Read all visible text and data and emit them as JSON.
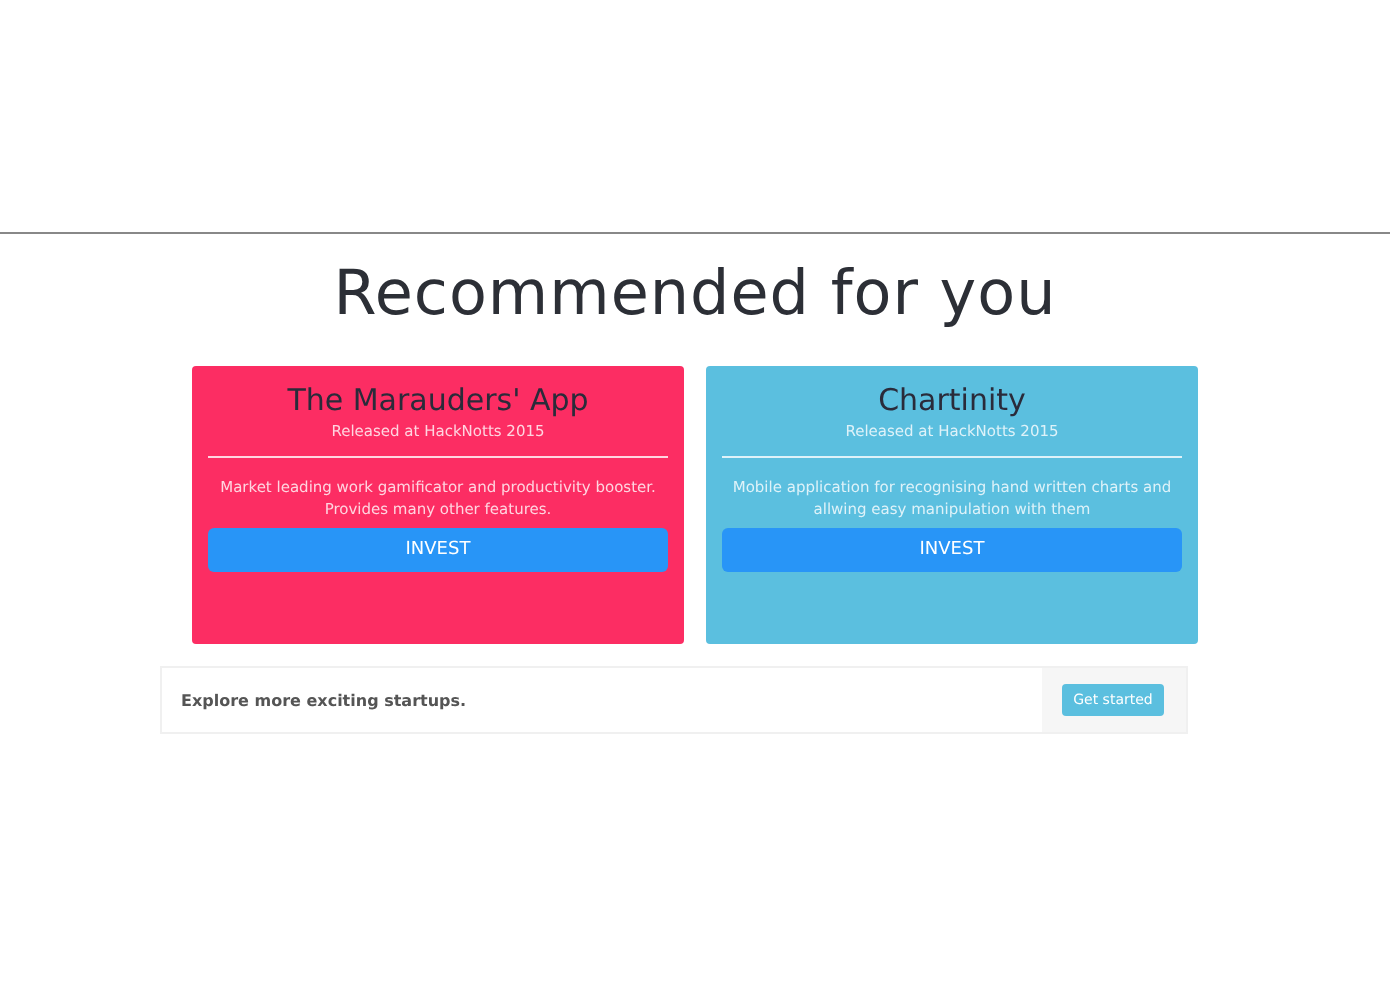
{
  "heading": "Recommended for you",
  "cards": [
    {
      "title": "The Marauders' App",
      "subtitle": "Released at HackNotts 2015",
      "description": "Market leading work gamificator and productivity booster. Provides many other features.",
      "button": "INVEST",
      "color": "#fc2d63"
    },
    {
      "title": "Chartinity",
      "subtitle": "Released at HackNotts 2015",
      "description": "Mobile application for recognising hand written charts and allwing easy manipulation with them",
      "button": "INVEST",
      "color": "#5bbfdf"
    }
  ],
  "footer": {
    "text": "Explore more exciting startups.",
    "button": "Get started"
  }
}
